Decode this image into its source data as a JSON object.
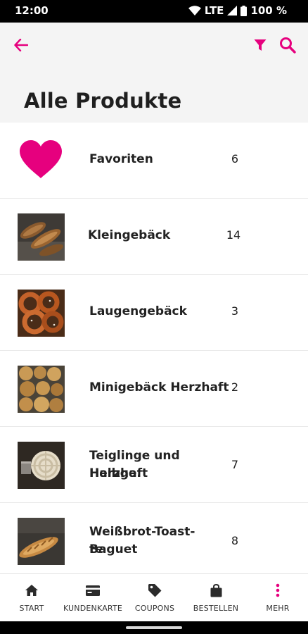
{
  "status": {
    "time": "12:00",
    "network": "LTE",
    "battery": "100 %"
  },
  "header": {
    "back_icon": "arrow-left-icon",
    "filter_icon": "filter-icon",
    "search_icon": "search-icon",
    "title": "Alle Produkte",
    "accent_color": "#e6007e"
  },
  "categories": [
    {
      "label": "Favoriten",
      "count": "6",
      "icon": "heart-icon"
    },
    {
      "label": "Kleingebäck",
      "count": "14"
    },
    {
      "label": "Laugengebäck",
      "count": "3"
    },
    {
      "label": "Minigebäck Herzhaft",
      "count": "2"
    },
    {
      "label_line1": "Teiglinge und Halbge.",
      "label_line2": "Herzhaft",
      "count": "7"
    },
    {
      "label_line1": "Weißbrot-Toast-Baguet",
      "label_line2": "te",
      "count": "8"
    }
  ],
  "nav": {
    "items": [
      {
        "label": "START",
        "icon": "home-icon"
      },
      {
        "label": "KUNDENKARTE",
        "icon": "card-icon"
      },
      {
        "label": "COUPONS",
        "icon": "tag-icon"
      },
      {
        "label": "BESTELLEN",
        "icon": "shopping-bag-icon"
      },
      {
        "label": "MEHR",
        "icon": "more-vertical-icon"
      }
    ]
  }
}
